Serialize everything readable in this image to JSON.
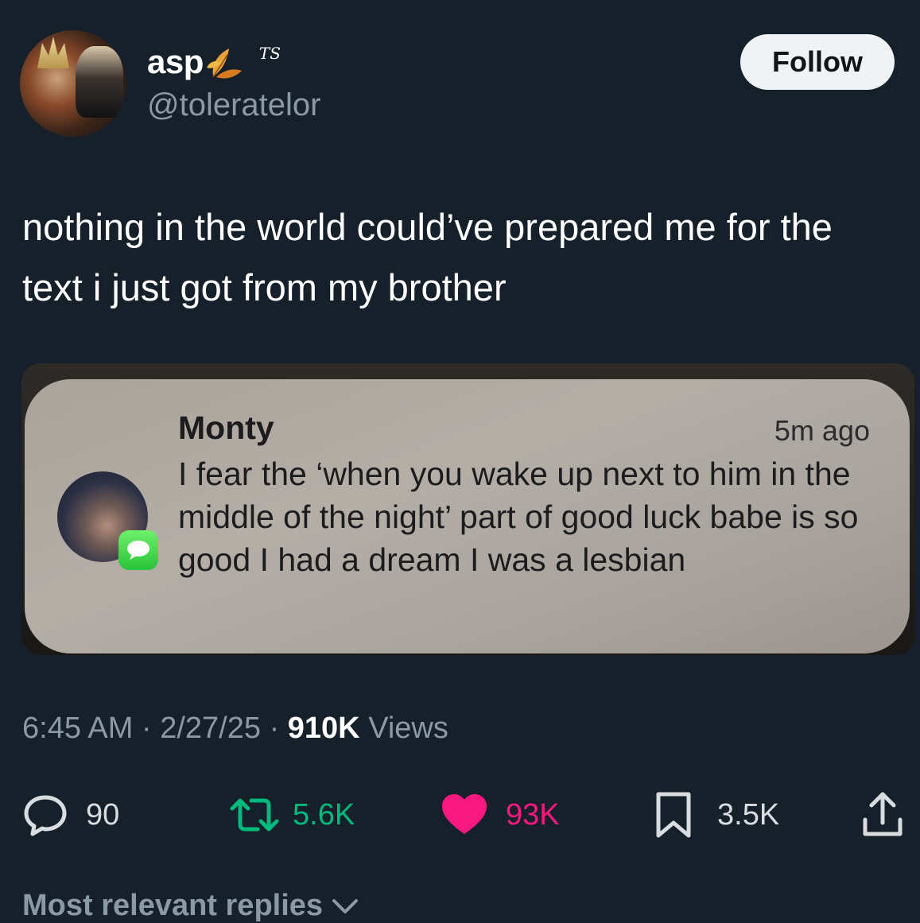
{
  "author": {
    "display_name": "asp",
    "tag": "TS",
    "handle": "@toleratelor",
    "follow_label": "Follow"
  },
  "tweet": {
    "text": "nothing in the world could’ve prepared me for the text i just got from my brother"
  },
  "notification": {
    "sender": "Monty",
    "time": "5m ago",
    "body": "I fear the ‘when you wake up next to him in the middle of the night’ part of good luck babe is so good I had a dream I was a lesbian",
    "app_icon": "messages-icon"
  },
  "meta": {
    "time": "6:45 AM",
    "date": "2/27/25",
    "views_count": "910K",
    "views_label": "Views",
    "separator": "·"
  },
  "actions": {
    "replies": "90",
    "reposts": "5.6K",
    "likes": "93K",
    "bookmarks": "3.5K"
  },
  "replies_section": {
    "label": "Most relevant replies"
  },
  "colors": {
    "background": "#15202b",
    "repost_green": "#00ba7c",
    "like_pink": "#f91880",
    "muted": "#8b98a5"
  }
}
